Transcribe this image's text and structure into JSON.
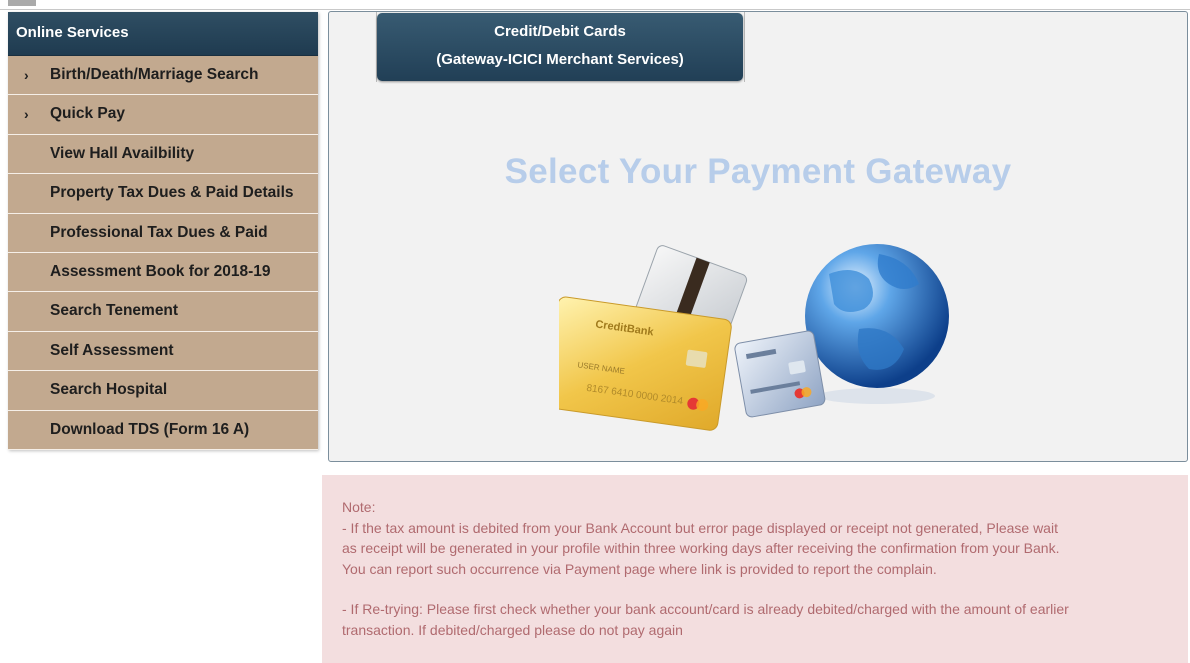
{
  "sidebar": {
    "title": "Online Services",
    "items": [
      {
        "label": "Birth/Death/Marriage Search",
        "chevron": true
      },
      {
        "label": "Quick Pay",
        "chevron": true
      },
      {
        "label": "View Hall Availbility",
        "chevron": false
      },
      {
        "label": "Property Tax Dues & Paid Details",
        "chevron": false
      },
      {
        "label": "Professional Tax Dues & Paid",
        "chevron": false
      },
      {
        "label": "Assessment Book for 2018-19",
        "chevron": false
      },
      {
        "label": "Search Tenement",
        "chevron": false
      },
      {
        "label": "Self Assessment",
        "chevron": false
      },
      {
        "label": "Search Hospital",
        "chevron": false
      },
      {
        "label": "Download TDS (Form 16 A)",
        "chevron": false
      }
    ],
    "chevron_glyph": "›"
  },
  "gateway": {
    "tab_line1": "Credit/Debit Cards",
    "tab_line2": "(Gateway-ICICI Merchant Services)",
    "heading": "Select Your Payment Gateway",
    "card_text_brand": "CreditBank",
    "card_text_name": "USER NAME",
    "card_text_number": "8167 6410 0000 2014"
  },
  "note": {
    "title": "Note:",
    "para1_line1": "- If the tax amount is debited from your Bank Account but error page displayed or receipt not generated, Please wait",
    "para1_line2": "as receipt will be generated in your profile within three working days after receiving the confirmation from your Bank.",
    "para1_line3": "You can report such occurrence via Payment page where link is provided to report the complain.",
    "para2_line1": "- If Re-trying: Please first check whether your bank account/card is already debited/charged with the amount of earlier",
    "para2_line2": "transaction. If debited/charged please do not pay again"
  },
  "colors": {
    "sidebar_header": "#1f3b50",
    "sidebar_item": "#c2a98f",
    "heading": "#b7cdea",
    "note_bg": "#f3dedf",
    "note_text": "#b06a6f"
  }
}
